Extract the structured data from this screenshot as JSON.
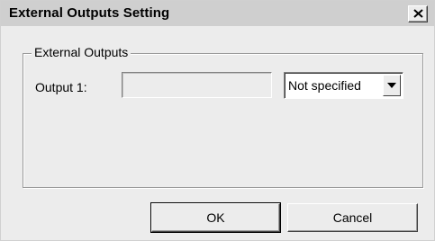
{
  "window": {
    "title": "External Outputs Setting",
    "close_glyph": "close-icon"
  },
  "group": {
    "legend": "External Outputs",
    "output1_label": "Output 1:",
    "output1_value": "",
    "output1_select_value": "Not specified"
  },
  "buttons": {
    "ok_label": "OK",
    "cancel_label": "Cancel"
  },
  "colors": {
    "dialog_bg": "#ececec",
    "titlebar_bg": "#cfcfcf"
  }
}
